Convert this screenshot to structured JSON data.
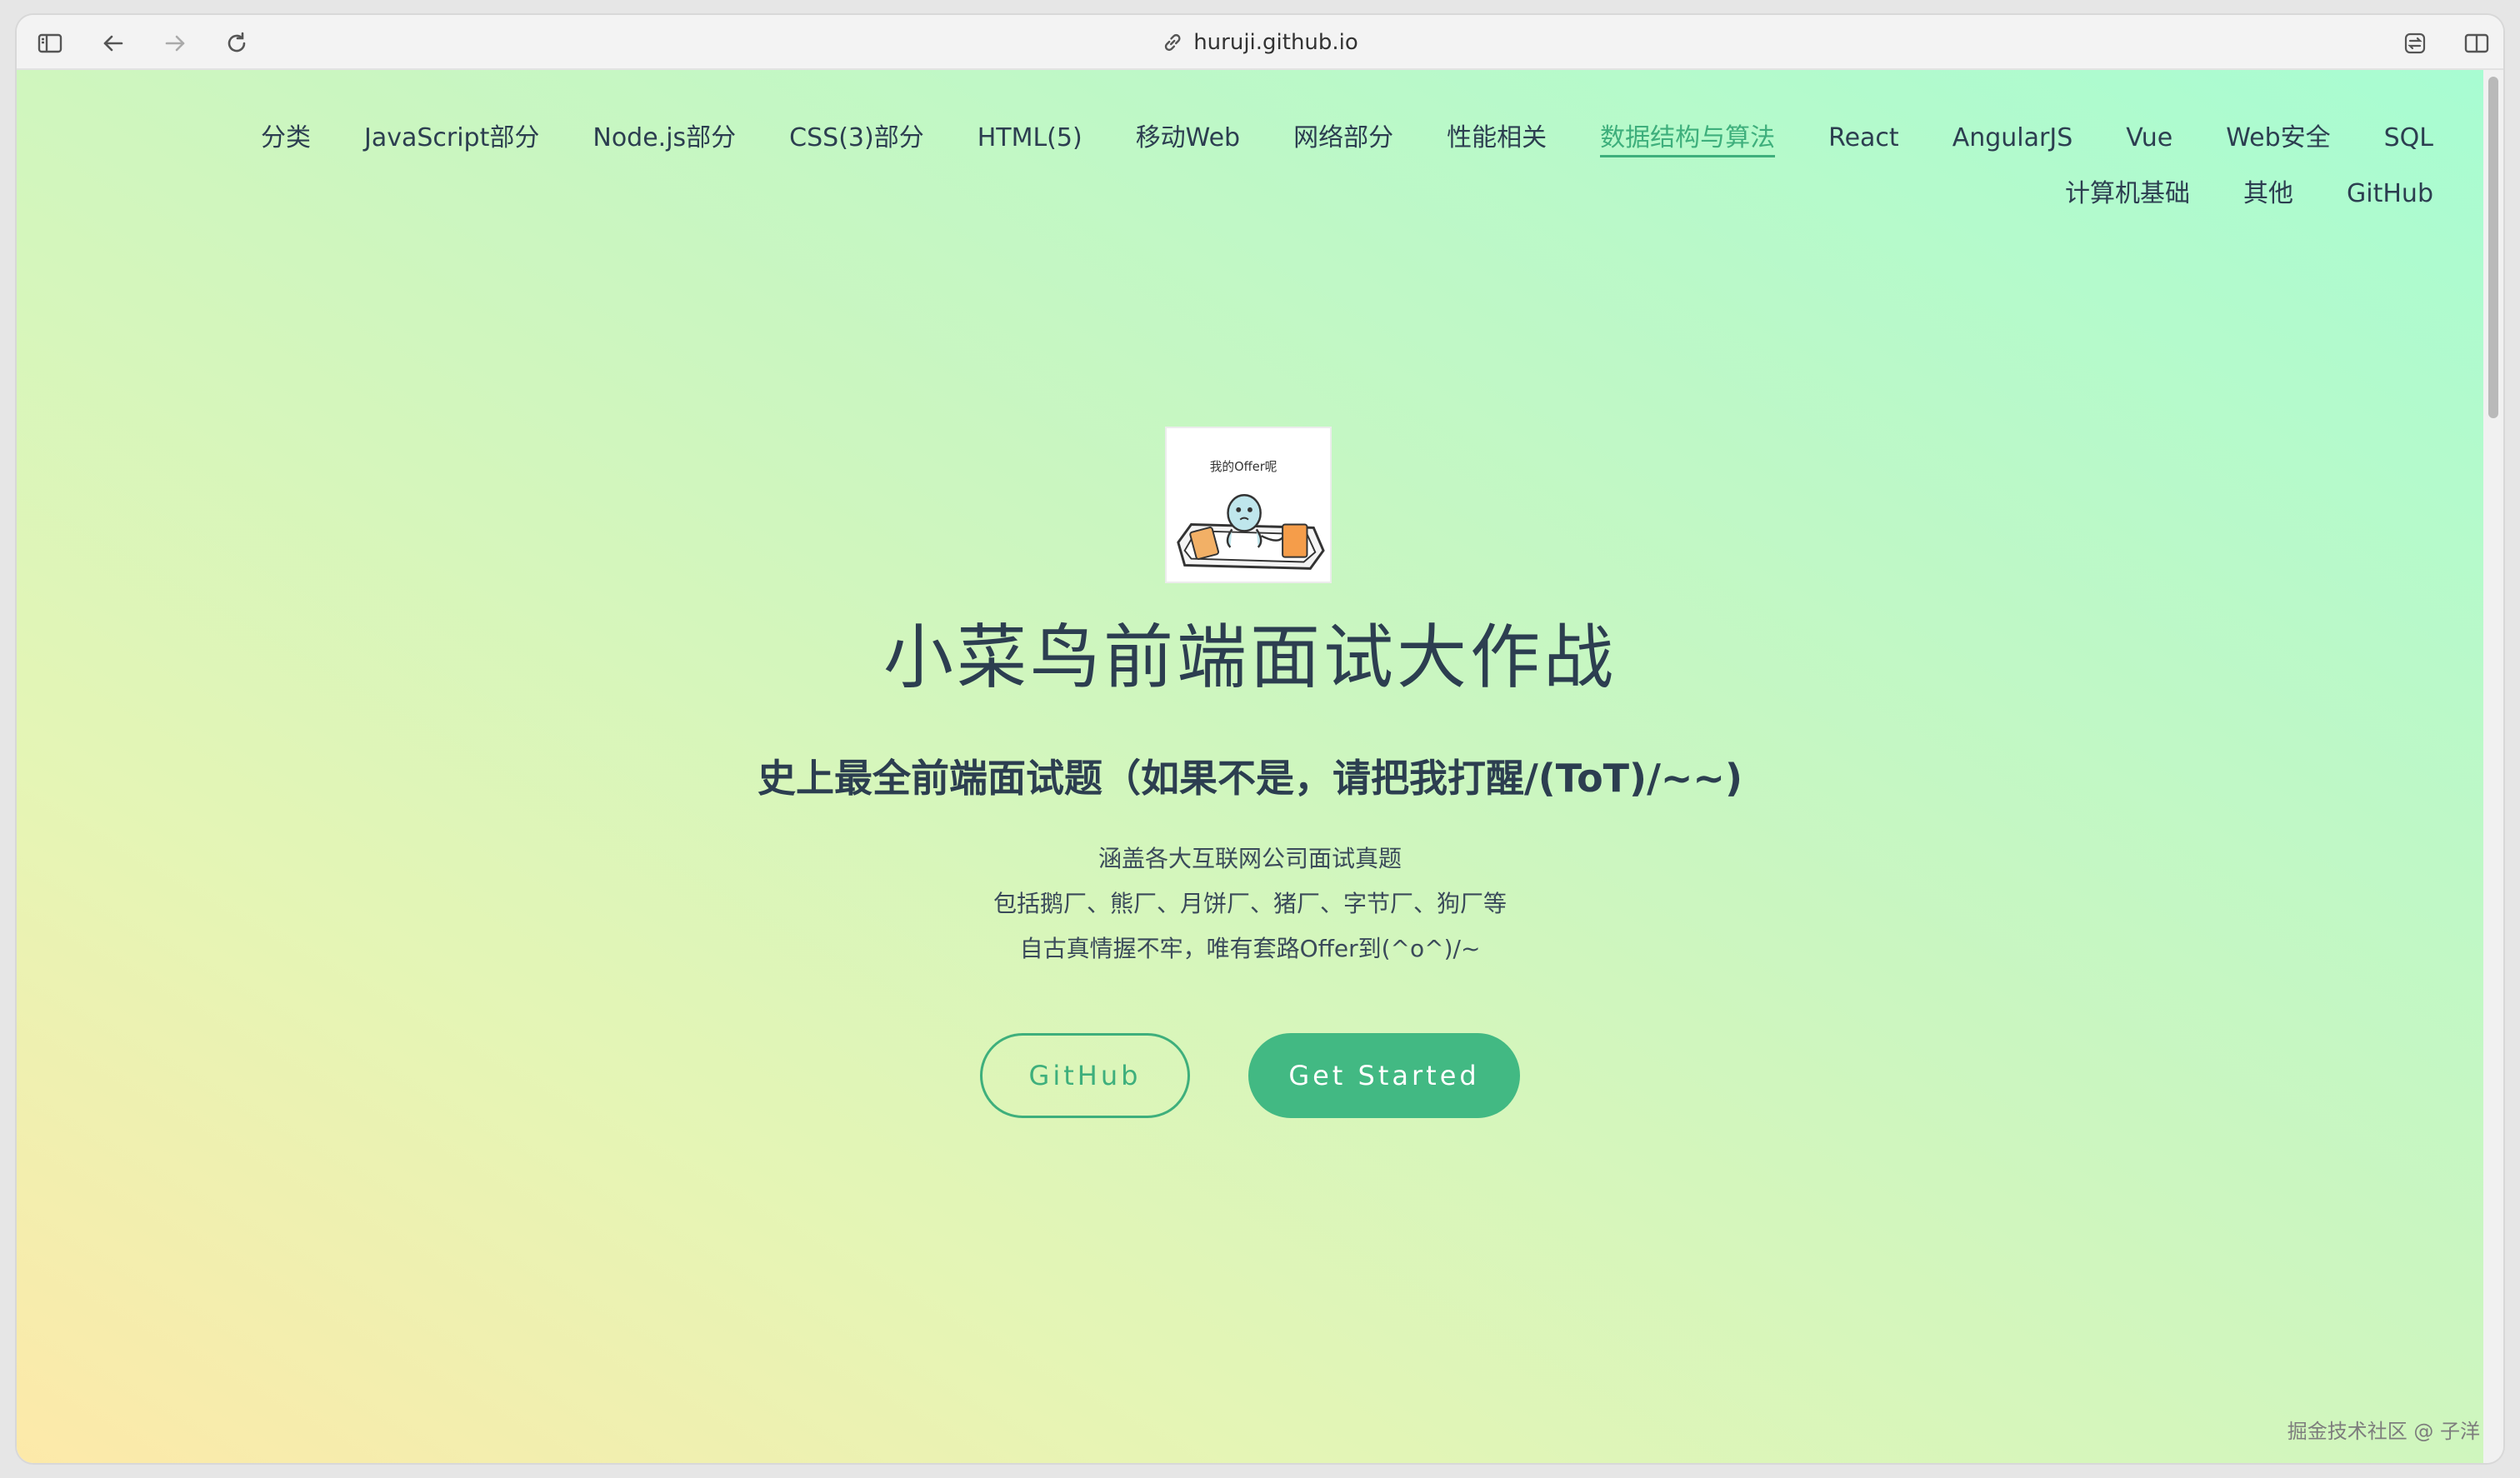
{
  "browser": {
    "url": "huruji.github.io"
  },
  "nav": {
    "row1": [
      {
        "label": "分类",
        "active": false
      },
      {
        "label": "JavaScript部分",
        "active": false
      },
      {
        "label": "Node.js部分",
        "active": false
      },
      {
        "label": "CSS(3)部分",
        "active": false
      },
      {
        "label": "HTML(5)",
        "active": false
      },
      {
        "label": "移动Web",
        "active": false
      },
      {
        "label": "网络部分",
        "active": false
      },
      {
        "label": "性能相关",
        "active": false
      },
      {
        "label": "数据结构与算法",
        "active": true
      },
      {
        "label": "React",
        "active": false
      },
      {
        "label": "AngularJS",
        "active": false
      },
      {
        "label": "Vue",
        "active": false
      },
      {
        "label": "Web安全",
        "active": false
      },
      {
        "label": "SQL",
        "active": false
      }
    ],
    "row2": [
      {
        "label": "计算机基础",
        "active": false
      },
      {
        "label": "其他",
        "active": false
      },
      {
        "label": "GitHub",
        "active": false
      }
    ]
  },
  "hero": {
    "image_text": "我的Offer呢",
    "title": "小菜鸟前端面试大作战",
    "tagline": "史上最全前端面试题（如果不是，请把我打醒/(ToT)/~~)",
    "desc_lines": [
      "涵盖各大互联网公司面试真题",
      "包括鹅厂、熊厂、月饼厂、猪厂、字节厂、狗厂等",
      "自古真情握不牢，唯有套路Offer到(^o^)/~"
    ],
    "buttons": {
      "github": "GitHub",
      "get_started": "Get Started"
    }
  },
  "watermark": "掘金技术社区 @ 子洋",
  "colors": {
    "accent": "#3eaf7c",
    "primary_button": "#42b983",
    "text": "#2c3e50"
  }
}
